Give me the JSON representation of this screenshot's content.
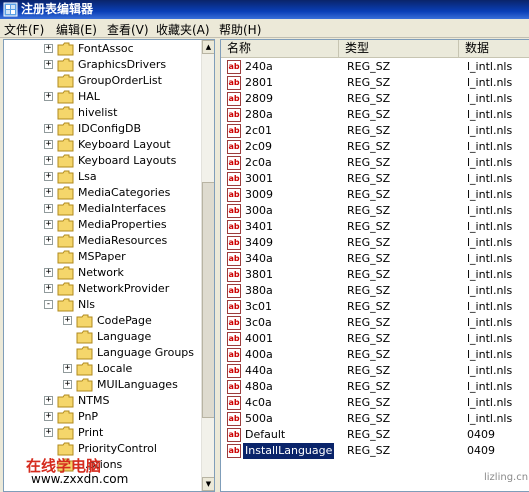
{
  "window": {
    "title": "注册表编辑器"
  },
  "menu": [
    "文件(F)",
    "编辑(E)",
    "查看(V)",
    "收藏夹(A)",
    "帮助(H)"
  ],
  "tree": [
    {
      "label": "FontAssoc",
      "expander": "+",
      "level": 0
    },
    {
      "label": "GraphicsDrivers",
      "expander": "+",
      "level": 0
    },
    {
      "label": "GroupOrderList",
      "expander": "",
      "level": 0
    },
    {
      "label": "HAL",
      "expander": "+",
      "level": 0
    },
    {
      "label": "hivelist",
      "expander": "",
      "level": 0
    },
    {
      "label": "IDConfigDB",
      "expander": "+",
      "level": 0
    },
    {
      "label": "Keyboard Layout",
      "expander": "+",
      "level": 0
    },
    {
      "label": "Keyboard Layouts",
      "expander": "+",
      "level": 0
    },
    {
      "label": "Lsa",
      "expander": "+",
      "level": 0
    },
    {
      "label": "MediaCategories",
      "expander": "+",
      "level": 0
    },
    {
      "label": "MediaInterfaces",
      "expander": "+",
      "level": 0
    },
    {
      "label": "MediaProperties",
      "expander": "+",
      "level": 0
    },
    {
      "label": "MediaResources",
      "expander": "+",
      "level": 0
    },
    {
      "label": "MSPaper",
      "expander": "",
      "level": 0
    },
    {
      "label": "Network",
      "expander": "+",
      "level": 0
    },
    {
      "label": "NetworkProvider",
      "expander": "+",
      "level": 0
    },
    {
      "label": "Nls",
      "expander": "-",
      "level": 0
    },
    {
      "label": "CodePage",
      "expander": "+",
      "level": 1
    },
    {
      "label": "Language",
      "expander": "",
      "level": 1
    },
    {
      "label": "Language Groups",
      "expander": "",
      "level": 1
    },
    {
      "label": "Locale",
      "expander": "+",
      "level": 1
    },
    {
      "label": "MUILanguages",
      "expander": "+",
      "level": 1
    },
    {
      "label": "NTMS",
      "expander": "+",
      "level": 0
    },
    {
      "label": "PnP",
      "expander": "+",
      "level": 0
    },
    {
      "label": "Print",
      "expander": "+",
      "level": 0
    },
    {
      "label": "PriorityControl",
      "expander": "",
      "level": 0
    },
    {
      "label": "...ptions",
      "expander": "",
      "level": 0
    }
  ],
  "list": {
    "columns": [
      "名称",
      "类型",
      "数据"
    ],
    "rows": [
      {
        "name": "240a",
        "type": "REG_SZ",
        "data": "l_intl.nls"
      },
      {
        "name": "2801",
        "type": "REG_SZ",
        "data": "l_intl.nls"
      },
      {
        "name": "2809",
        "type": "REG_SZ",
        "data": "l_intl.nls"
      },
      {
        "name": "280a",
        "type": "REG_SZ",
        "data": "l_intl.nls"
      },
      {
        "name": "2c01",
        "type": "REG_SZ",
        "data": "l_intl.nls"
      },
      {
        "name": "2c09",
        "type": "REG_SZ",
        "data": "l_intl.nls"
      },
      {
        "name": "2c0a",
        "type": "REG_SZ",
        "data": "l_intl.nls"
      },
      {
        "name": "3001",
        "type": "REG_SZ",
        "data": "l_intl.nls"
      },
      {
        "name": "3009",
        "type": "REG_SZ",
        "data": "l_intl.nls"
      },
      {
        "name": "300a",
        "type": "REG_SZ",
        "data": "l_intl.nls"
      },
      {
        "name": "3401",
        "type": "REG_SZ",
        "data": "l_intl.nls"
      },
      {
        "name": "3409",
        "type": "REG_SZ",
        "data": "l_intl.nls"
      },
      {
        "name": "340a",
        "type": "REG_SZ",
        "data": "l_intl.nls"
      },
      {
        "name": "3801",
        "type": "REG_SZ",
        "data": "l_intl.nls"
      },
      {
        "name": "380a",
        "type": "REG_SZ",
        "data": "l_intl.nls"
      },
      {
        "name": "3c01",
        "type": "REG_SZ",
        "data": "l_intl.nls"
      },
      {
        "name": "3c0a",
        "type": "REG_SZ",
        "data": "l_intl.nls"
      },
      {
        "name": "4001",
        "type": "REG_SZ",
        "data": "l_intl.nls"
      },
      {
        "name": "400a",
        "type": "REG_SZ",
        "data": "l_intl.nls"
      },
      {
        "name": "440a",
        "type": "REG_SZ",
        "data": "l_intl.nls"
      },
      {
        "name": "480a",
        "type": "REG_SZ",
        "data": "l_intl.nls"
      },
      {
        "name": "4c0a",
        "type": "REG_SZ",
        "data": "l_intl.nls"
      },
      {
        "name": "500a",
        "type": "REG_SZ",
        "data": "l_intl.nls"
      },
      {
        "name": "Default",
        "type": "REG_SZ",
        "data": "0409"
      },
      {
        "name": "InstallLanguage",
        "type": "REG_SZ",
        "data": "0409",
        "selected": true
      }
    ]
  },
  "overlay": {
    "site_cn": "在线学电脑",
    "site_url": "www.zxxdn.com",
    "watermark": "lizling.cn"
  },
  "colors": {
    "title_bar": "#0a246a",
    "selection": "#0a246a",
    "folder": "#f5d66b",
    "overlay_red": "#d52b1e"
  }
}
